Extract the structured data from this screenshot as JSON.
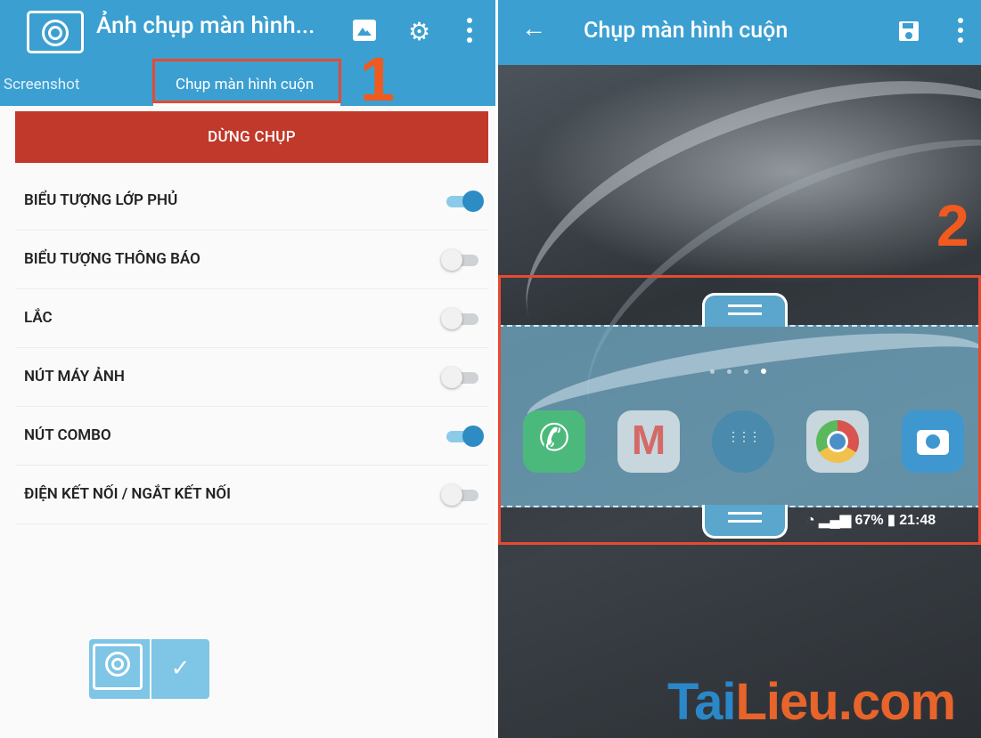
{
  "left_app": {
    "title": "Ảnh chụp màn hình...",
    "tabs": [
      "Screenshot",
      "Chụp màn hình cuộn"
    ],
    "stop_button": "DỪNG CHỤP",
    "settings": [
      {
        "label": "BIỂU TƯỢNG LỚP PHỦ",
        "enabled": true
      },
      {
        "label": "BIỂU TƯỢNG THÔNG BÁO",
        "enabled": false
      },
      {
        "label": "LẮC",
        "enabled": false
      },
      {
        "label": "NÚT MÁY ẢNH",
        "enabled": false
      },
      {
        "label": "NÚT COMBO",
        "enabled": true
      },
      {
        "label": "ĐIỆN KẾT NỐI / NGẮT KẾT NỐI",
        "enabled": false
      }
    ],
    "confirm_icon": "✓"
  },
  "right_app": {
    "title": "Chụp màn hình cuộn",
    "status": {
      "battery": "67%",
      "time": "21:48"
    }
  },
  "annotations": {
    "step1": "1",
    "step2": "2"
  },
  "watermark": {
    "part1": "T",
    "part2": "ai",
    "part3": "Lieu",
    "part4": ".com"
  },
  "colors": {
    "appbar": "#3b9fd1",
    "stop_button": "#c0392b",
    "highlight": "#e84a30",
    "toggle_on": "#2e8cc4"
  }
}
